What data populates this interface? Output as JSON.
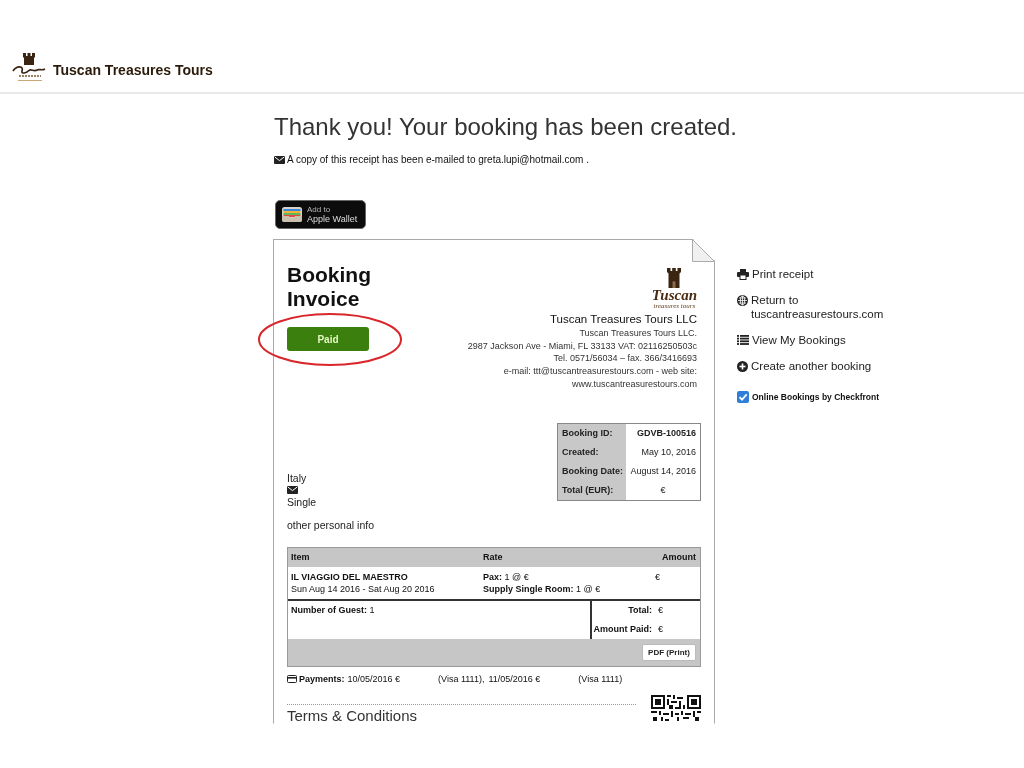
{
  "header": {
    "brand": "Tuscan Treasures Tours"
  },
  "confirmation": {
    "title": "Thank you! Your booking has been created.",
    "email_notice": "A copy of this receipt has been e-mailed to greta.lupi@hotmail.com ."
  },
  "wallet_button": {
    "small_label": "Add to",
    "label": "Apple Wallet"
  },
  "invoice": {
    "title": "Booking Invoice",
    "status": {
      "label": "Paid",
      "circled": true
    },
    "logo": {
      "wordmark": "Tuscan",
      "tagline": "treasures tours"
    },
    "company": {
      "name": "Tuscan Treasures Tours LLC",
      "lines": [
        "Tuscan Treasures Tours LLC.",
        "2987 Jackson Ave - Miami, FL 33133 VAT: 02116250503c",
        "Tel. 0571/56034 – fax. 366/3416693",
        "e-mail: ttt@tuscantreasurestours.com - web site:",
        "www.tuscantreasurestours.com"
      ]
    },
    "summary": [
      {
        "label": "Booking ID:",
        "value": "GDVB-100516",
        "kind": "id"
      },
      {
        "label": "Created:",
        "value": "May 10, 2016",
        "kind": "date"
      },
      {
        "label": "Booking Date:",
        "value": "August 14, 2016",
        "kind": "date"
      },
      {
        "label": "Total (EUR):",
        "value": "€",
        "kind": "amount"
      }
    ],
    "customer": {
      "country": "Italy",
      "room": "Single",
      "notes": "other personal info"
    },
    "items_table": {
      "columns": [
        "Item",
        "Rate",
        "Amount"
      ],
      "rows": [
        {
          "item": "IL VIAGGIO DEL MAESTRO",
          "dates": "Sun Aug 14 2016 - Sat Aug 20 2016",
          "rates": [
            "**Pax:** 1 @ €",
            "**Supply Single Room:** 1 @ €"
          ],
          "amount": "€"
        }
      ],
      "guests": "**Number of Guest:** 1",
      "totals": [
        {
          "label": "Total:",
          "value": "€"
        },
        {
          "label": "Amount Paid:",
          "value": "€"
        }
      ],
      "pdf_button": "PDF (Print)"
    },
    "payments": {
      "label": "Payments:",
      "entries": [
        {
          "date": "10/05/2016 €",
          "card": "(Visa 1111),"
        },
        {
          "date": "11/05/2016 €",
          "card": "(Visa 1111)"
        }
      ]
    },
    "terms_title": "Terms & Conditions"
  },
  "sidebar": {
    "links": [
      {
        "kind": "print",
        "label": "Print receipt"
      },
      {
        "kind": "website",
        "label": "Return to tuscantreasurestours.com"
      },
      {
        "kind": "bookings",
        "label": "View My Bookings"
      },
      {
        "kind": "new",
        "label": "Create another booking"
      }
    ],
    "powered_by": {
      "label": "Online Bookings by Checkfront",
      "checked": true
    }
  }
}
